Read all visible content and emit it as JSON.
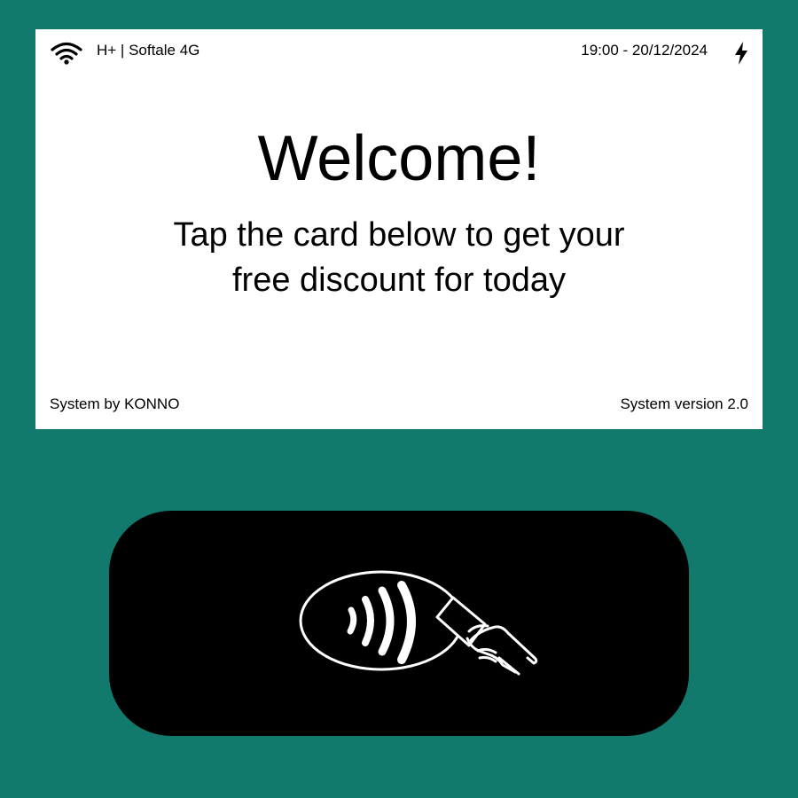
{
  "status_bar": {
    "network": "H+ | Softale 4G",
    "datetime": "19:00 - 20/12/2024",
    "wifi_icon": "wifi-icon",
    "charging_icon": "charging-bolt-icon"
  },
  "main": {
    "title": "Welcome!",
    "subtitle": "Tap the card below to get your free discount for today"
  },
  "footer": {
    "left_text": "System by KONNO",
    "right_text": "System version 2.0"
  },
  "tap_card": {
    "icon": "contactless-tap-icon"
  },
  "colors": {
    "background": "#117a6d",
    "screen": "#ffffff",
    "card": "#000000"
  }
}
